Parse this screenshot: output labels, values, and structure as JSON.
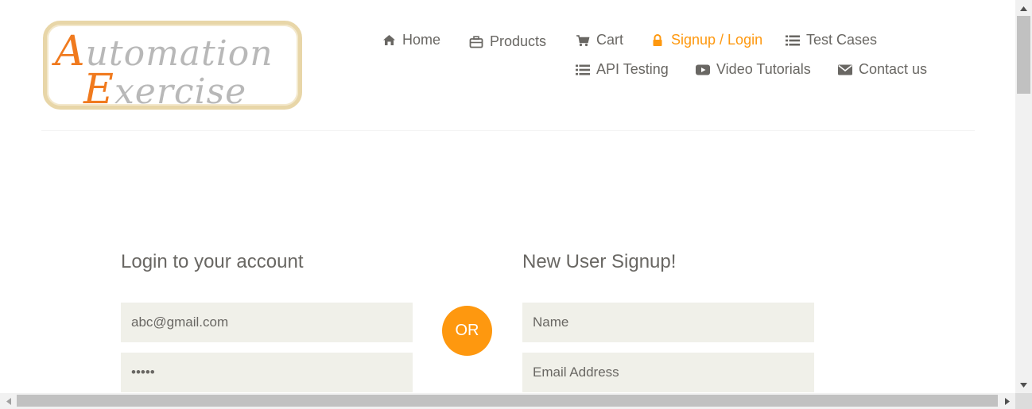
{
  "logo": {
    "line1_initial": "A",
    "line1_rest": "utomation",
    "line2_initial": "E",
    "line2_rest": "xercise"
  },
  "nav": {
    "home": {
      "label": "Home",
      "icon": "home-icon"
    },
    "products": {
      "label": "Products",
      "icon": "products-icon"
    },
    "cart": {
      "label": "Cart",
      "icon": "cart-icon"
    },
    "signup_login": {
      "label": "Signup / Login",
      "icon": "lock-icon",
      "active": true
    },
    "test_cases": {
      "label": "Test Cases",
      "icon": "list-icon"
    },
    "api_testing": {
      "label": "API Testing",
      "icon": "list-icon"
    },
    "video_tutorials": {
      "label": "Video Tutorials",
      "icon": "youtube-icon"
    },
    "contact_us": {
      "label": "Contact us",
      "icon": "envelope-icon"
    }
  },
  "login": {
    "title": "Login to your account",
    "email_value": "abc@gmail.com",
    "password_value": "•••••"
  },
  "divider": {
    "label": "OR"
  },
  "signup": {
    "title": "New User Signup!",
    "name_placeholder": "Name",
    "email_placeholder": "Email Address"
  },
  "colors": {
    "accent": "#fe980f",
    "text": "#696763",
    "field_bg": "#f0f0e9"
  }
}
